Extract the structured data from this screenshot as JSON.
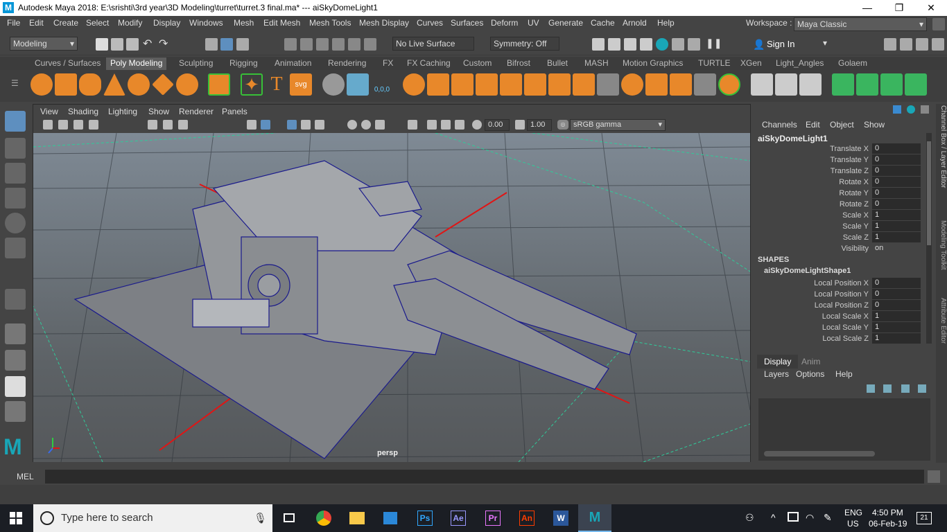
{
  "titlebar": {
    "title": "Autodesk Maya 2018: E:\\srishti\\3rd year\\3D Modeling\\turret\\turret.3 final.ma*    ---    aiSkyDomeLight1",
    "minimize": "—",
    "restore": "❐",
    "close": "✕"
  },
  "menubar": {
    "items": [
      "File",
      "Edit",
      "Create",
      "Select",
      "Modify",
      "Display",
      "Windows",
      "Mesh",
      "Edit Mesh",
      "Mesh Tools",
      "Mesh Display",
      "Curves",
      "Surfaces",
      "Deform",
      "UV",
      "Generate",
      "Cache",
      "Arnold",
      "Help"
    ],
    "workspace_label": "Workspace :",
    "workspace_value": "Maya Classic"
  },
  "statusline": {
    "menuset": "Modeling",
    "live_surface": "No Live Surface",
    "symmetry": "Symmetry: Off",
    "sign_in": "Sign In"
  },
  "shelf": {
    "tabs": [
      "Curves / Surfaces",
      "Poly Modeling",
      "Sculpting",
      "Rigging",
      "Animation",
      "Rendering",
      "FX",
      "FX Caching",
      "Custom",
      "Bifrost",
      "Bullet",
      "MASH",
      "Motion Graphics",
      "TURTLE",
      "XGen",
      "Light_Angles",
      "Golaem"
    ],
    "active_tab": "Poly Modeling",
    "text_icon_t": "T",
    "text_icon_svg": "svg",
    "mirror_label": "0,0,0"
  },
  "viewport": {
    "menus": [
      "View",
      "Shading",
      "Lighting",
      "Show",
      "Renderer",
      "Panels"
    ],
    "exposure": "0.00",
    "gamma": "1.00",
    "colorspace": "sRGB gamma",
    "camera_label": "persp"
  },
  "channelbox": {
    "tabs": [
      "Channels",
      "Edit",
      "Object",
      "Show"
    ],
    "node": "aiSkyDomeLight1",
    "attrs": [
      {
        "label": "Translate X",
        "value": "0"
      },
      {
        "label": "Translate Y",
        "value": "0"
      },
      {
        "label": "Translate Z",
        "value": "0"
      },
      {
        "label": "Rotate X",
        "value": "0"
      },
      {
        "label": "Rotate Y",
        "value": "0"
      },
      {
        "label": "Rotate Z",
        "value": "0"
      },
      {
        "label": "Scale X",
        "value": "1"
      },
      {
        "label": "Scale Y",
        "value": "1"
      },
      {
        "label": "Scale Z",
        "value": "1"
      },
      {
        "label": "Visibility",
        "value": "on"
      }
    ],
    "shapes_header": "SHAPES",
    "shape_node": "aiSkyDomeLightShape1",
    "shape_attrs": [
      {
        "label": "Local Position X",
        "value": "0"
      },
      {
        "label": "Local Position Y",
        "value": "0"
      },
      {
        "label": "Local Position Z",
        "value": "0"
      },
      {
        "label": "Local Scale X",
        "value": "1"
      },
      {
        "label": "Local Scale Y",
        "value": "1"
      },
      {
        "label": "Local Scale Z",
        "value": "1"
      }
    ]
  },
  "layereditor": {
    "tabs": [
      "Display",
      "Anim"
    ],
    "menus": [
      "Layers",
      "Options",
      "Help"
    ]
  },
  "rightdock": {
    "labels": [
      "Channel Box / Layer Editor",
      "Modeling Toolkit",
      "Attribute Editor"
    ]
  },
  "commandline": {
    "label": "MEL"
  },
  "taskbar": {
    "search_placeholder": "Type here to search",
    "lang1": "ENG",
    "lang2": "US",
    "time": "4:50 PM",
    "date": "06-Feb-19",
    "notif": "21",
    "apps": [
      {
        "name": "ps",
        "label": "Ps",
        "color": "#31a8ff",
        "bg": "#001e36"
      },
      {
        "name": "ae",
        "label": "Ae",
        "color": "#9999ff",
        "bg": "#00005b"
      },
      {
        "name": "pr",
        "label": "Pr",
        "color": "#ea77ff",
        "bg": "#2a0033"
      },
      {
        "name": "an",
        "label": "An",
        "color": "#ff3d00",
        "bg": "#2b0000"
      }
    ]
  },
  "colors": {
    "accent": "#0696d7",
    "grid": "#2ecc9a",
    "wire": "#1a1a8c",
    "axis_red": "#e01515"
  }
}
